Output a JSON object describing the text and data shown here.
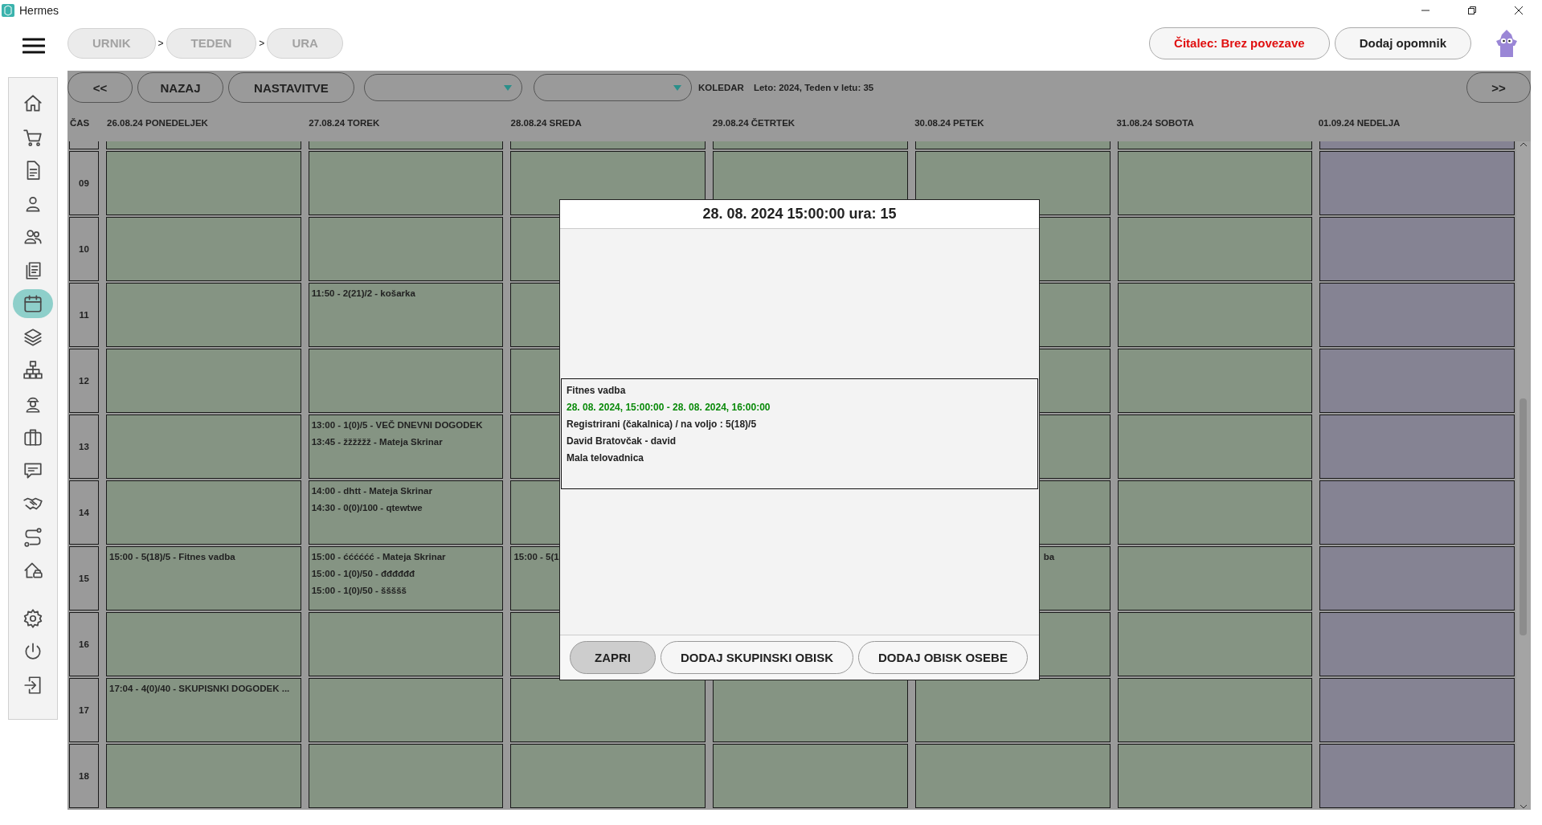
{
  "window": {
    "title": "Hermes"
  },
  "breadcrumbs": [
    {
      "kind": "crumb",
      "label": "URNIK"
    },
    {
      "kind": "separator",
      "label": ">"
    },
    {
      "kind": "crumb",
      "label": "TEDEN"
    },
    {
      "kind": "separator",
      "label": ">"
    },
    {
      "kind": "crumb",
      "label": "URA"
    }
  ],
  "top_actions": [
    {
      "kind": "status",
      "label": "Čitalec: Brez povezave"
    },
    {
      "kind": "action",
      "label": "Dodaj opomnik"
    }
  ],
  "sidebar": {
    "items": [
      {
        "selected": false
      },
      {
        "selected": false
      },
      {
        "selected": false
      },
      {
        "selected": false
      },
      {
        "selected": false
      },
      {
        "selected": false
      },
      {
        "selected": true
      },
      {
        "selected": false
      },
      {
        "selected": false
      },
      {
        "selected": false
      },
      {
        "selected": false
      },
      {
        "selected": false
      },
      {
        "selected": false
      },
      {
        "selected": false
      },
      {
        "selected": false
      }
    ],
    "bottom_items": [
      {
        "selected": false
      },
      {
        "selected": false
      },
      {
        "selected": false
      }
    ]
  },
  "toolbar": {
    "prev": "<<",
    "back": "NAZAJ",
    "settings": "NASTAVITVE",
    "dropdowns": [
      {
        "kind": "select"
      },
      {
        "kind": "select"
      }
    ],
    "calendar_label": "KOLEDAR",
    "week_info": "Leto: 2024, Teden v letu: 35",
    "next": ">>"
  },
  "time_header": "ČAS",
  "hours": [
    "09",
    "10",
    "11",
    "12",
    "13",
    "14",
    "15",
    "16",
    "17",
    "18"
  ],
  "days": [
    {
      "label": "26.08.24 PONEDELJEK",
      "color": "#859483",
      "cells": [
        {},
        {},
        {},
        {},
        {},
        {},
        {
          "events": [
            {
              "text": "15:00 - 5(18)/5 - Fitnes vadba",
              "clipped": false
            }
          ]
        },
        {},
        {
          "events": [
            {
              "text": "17:04 - 4(0)/40 - SKUPISNKI DOGODEK ...",
              "clipped": false
            }
          ]
        },
        {}
      ]
    },
    {
      "label": "27.08.24 TOREK",
      "color": "#859483",
      "cells": [
        {},
        {},
        {
          "events": [
            {
              "text": "11:50 - 2(21)/2 - košarka",
              "clipped": false
            }
          ]
        },
        {},
        {
          "events": [
            {
              "text": "13:00 - 1(0)/5 - VEČ DNEVNI DOGODEK",
              "clipped": false
            },
            {
              "text": "13:45 - žžžžžž - Mateja Skrinar",
              "clipped": false
            }
          ]
        },
        {
          "events": [
            {
              "text": "14:00 - dhtt - Mateja Skrinar",
              "clipped": false
            },
            {
              "text": "14:30 - 0(0)/100 - qtewtwe",
              "clipped": false
            }
          ]
        },
        {
          "events": [
            {
              "text": "15:00 - ćććććć - Mateja Skrinar",
              "clipped": false
            },
            {
              "text": "15:00 - 1(0)/50 - đđđđđđ",
              "clipped": false
            },
            {
              "text": "15:00 - 1(0)/50 - ššššš",
              "clipped": false
            }
          ]
        },
        {},
        {},
        {}
      ]
    },
    {
      "label": "28.08.24 SREDA",
      "color": "#859483",
      "cells": [
        {},
        {},
        {},
        {},
        {},
        {},
        {
          "events": [
            {
              "text": "15:00 - 5(1",
              "clipped": false
            }
          ]
        },
        {},
        {},
        {}
      ]
    },
    {
      "label": "29.08.24 ČETRTEK",
      "color": "#859483",
      "cells": [
        {},
        null,
        null,
        null,
        null,
        null,
        null,
        null,
        {},
        {}
      ]
    },
    {
      "label": "30.08.24 PETEK",
      "color": "#859483",
      "cells": [
        {},
        {},
        {},
        {},
        {},
        {},
        {
          "events": [
            {
              "text": "ba",
              "clipped": true
            }
          ]
        },
        {},
        {},
        {}
      ]
    },
    {
      "label": "31.08.24 SOBOTA",
      "color": "#859483",
      "cells": [
        {},
        {},
        {},
        {},
        {},
        {},
        {},
        {},
        {},
        {}
      ]
    },
    {
      "label": "01.09.24 NEDELJA",
      "color": "#858393",
      "cells": [
        {},
        {},
        {},
        {},
        {},
        {},
        {},
        {},
        {},
        {}
      ]
    }
  ],
  "dialog": {
    "title": "28. 08. 2024 15:00:00 ura: 15",
    "details": [
      {
        "kind": "name",
        "text": "Fitnes vadba"
      },
      {
        "kind": "time",
        "text": "28. 08. 2024, 15:00:00 - 28. 08. 2024, 16:00:00"
      },
      {
        "kind": "plain",
        "text": "Registrirani (čakalnica) / na voljo  :  5(18)/5"
      },
      {
        "kind": "plain",
        "text": "David Bratovčak - david"
      },
      {
        "kind": "plain",
        "text": "Mala telovadnica"
      }
    ],
    "buttons": [
      {
        "kind": "close",
        "label": "ZAPRI"
      },
      {
        "kind": "action",
        "label": "DODAJ SKUPINSKI OBISK"
      },
      {
        "kind": "action",
        "label": "DODAJ OBISK OSEBE"
      }
    ]
  }
}
